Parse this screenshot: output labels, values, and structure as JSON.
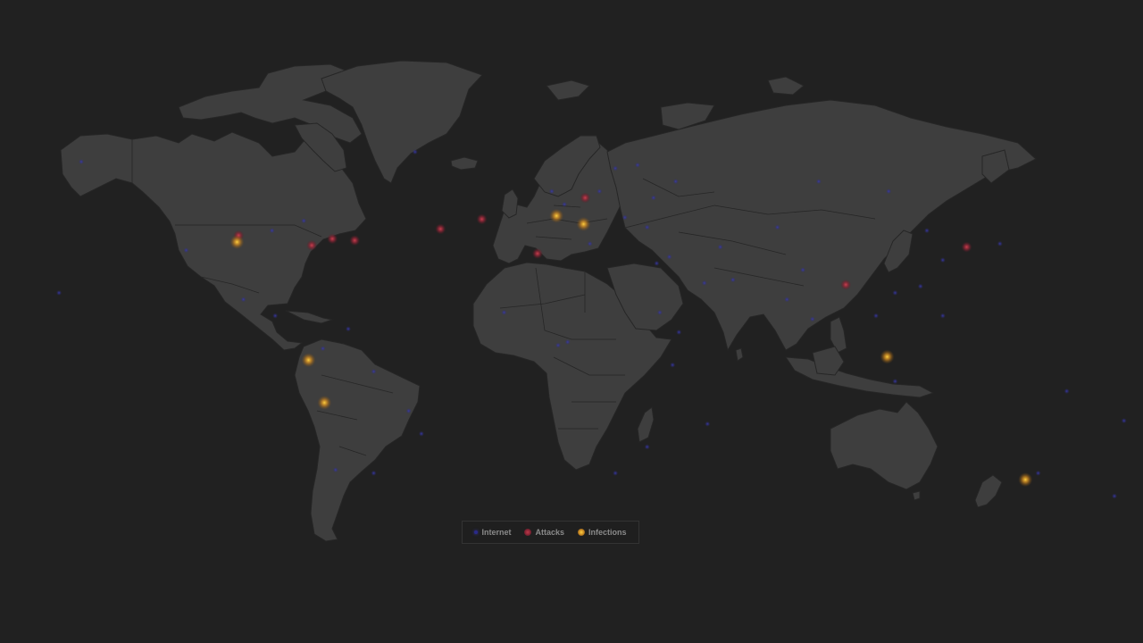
{
  "map": {
    "background": "#212121",
    "land_color": "#3e3e3e",
    "border_color": "#262626"
  },
  "legend": {
    "items": [
      {
        "label": "Internet",
        "color": "#2a2a8a",
        "icon": "internet-dot-icon"
      },
      {
        "label": "Attacks",
        "color": "#9a2a3a",
        "icon": "attack-dot-icon"
      },
      {
        "label": "Infections",
        "color": "#e8a020",
        "icon": "infection-dot-icon"
      }
    ]
  },
  "markers": {
    "attacks": [
      {
        "lon": -100.5,
        "lat": 38.5
      },
      {
        "lon": -77.5,
        "lat": 35.5
      },
      {
        "lon": -71.0,
        "lat": 37.5
      },
      {
        "lon": -64.0,
        "lat": 37.0
      },
      {
        "lon": -37.0,
        "lat": 40.5
      },
      {
        "lon": -24.0,
        "lat": 43.5
      },
      {
        "lon": 8.5,
        "lat": 50.0
      },
      {
        "lon": -6.5,
        "lat": 33.0
      },
      {
        "lon": 90.5,
        "lat": 23.5
      },
      {
        "lon": 128.5,
        "lat": 35.0
      }
    ],
    "infections": [
      {
        "lon": -101.0,
        "lat": 36.5
      },
      {
        "lon": -0.5,
        "lat": 44.5
      },
      {
        "lon": 8.0,
        "lat": 42.0
      },
      {
        "lon": -78.5,
        "lat": 0.5
      },
      {
        "lon": -73.5,
        "lat": -12.5
      },
      {
        "lon": 103.5,
        "lat": 1.5
      },
      {
        "lon": 147.0,
        "lat": -36.0
      }
    ],
    "internet": [
      {
        "lon": -80,
        "lat": 43
      },
      {
        "lon": -90,
        "lat": 40
      },
      {
        "lon": -117,
        "lat": 34
      },
      {
        "lon": -99,
        "lat": 19
      },
      {
        "lon": -89,
        "lat": 14
      },
      {
        "lon": -66,
        "lat": 10
      },
      {
        "lon": -74,
        "lat": 4
      },
      {
        "lon": -58,
        "lat": -3
      },
      {
        "lon": -47,
        "lat": -15
      },
      {
        "lon": -58,
        "lat": -34
      },
      {
        "lon": -70,
        "lat": -33
      },
      {
        "lon": -43,
        "lat": -22
      },
      {
        "lon": -2,
        "lat": 52
      },
      {
        "lon": 2,
        "lat": 48
      },
      {
        "lon": 13,
        "lat": 52
      },
      {
        "lon": 18,
        "lat": 59
      },
      {
        "lon": 25,
        "lat": 60
      },
      {
        "lon": 37,
        "lat": 55
      },
      {
        "lon": 30,
        "lat": 50
      },
      {
        "lon": 21,
        "lat": 44
      },
      {
        "lon": 28,
        "lat": 41
      },
      {
        "lon": 35,
        "lat": 32
      },
      {
        "lon": 31,
        "lat": 30
      },
      {
        "lon": 46,
        "lat": 24
      },
      {
        "lon": 55,
        "lat": 25
      },
      {
        "lon": 51,
        "lat": 35
      },
      {
        "lon": 69,
        "lat": 41
      },
      {
        "lon": 77,
        "lat": 28
      },
      {
        "lon": 72,
        "lat": 19
      },
      {
        "lon": 80,
        "lat": 13
      },
      {
        "lon": 100,
        "lat": 14
      },
      {
        "lon": 106,
        "lat": 21
      },
      {
        "lon": 116,
        "lat": 40
      },
      {
        "lon": 121,
        "lat": 31
      },
      {
        "lon": 114,
        "lat": 23
      },
      {
        "lon": 139,
        "lat": 36
      },
      {
        "lon": 121,
        "lat": 14
      },
      {
        "lon": 106,
        "lat": -6
      },
      {
        "lon": 3,
        "lat": 6
      },
      {
        "lon": -17,
        "lat": 15
      },
      {
        "lon": 36,
        "lat": -1
      },
      {
        "lon": 28,
        "lat": -26
      },
      {
        "lon": 18,
        "lat": -34
      },
      {
        "lon": 32,
        "lat": 15
      },
      {
        "lon": 38,
        "lat": 9
      },
      {
        "lon": 47,
        "lat": -19
      },
      {
        "lon": 151,
        "lat": -34
      },
      {
        "lon": 175,
        "lat": -41
      },
      {
        "lon": -150,
        "lat": 61
      },
      {
        "lon": -45,
        "lat": 64
      },
      {
        "lon": 82,
        "lat": 55
      },
      {
        "lon": 104,
        "lat": 52
      },
      {
        "lon": 160,
        "lat": -9
      },
      {
        "lon": 178,
        "lat": -18
      },
      {
        "lon": -157,
        "lat": 21
      },
      {
        "lon": 10,
        "lat": 36
      },
      {
        "lon": 0,
        "lat": 5
      }
    ]
  }
}
